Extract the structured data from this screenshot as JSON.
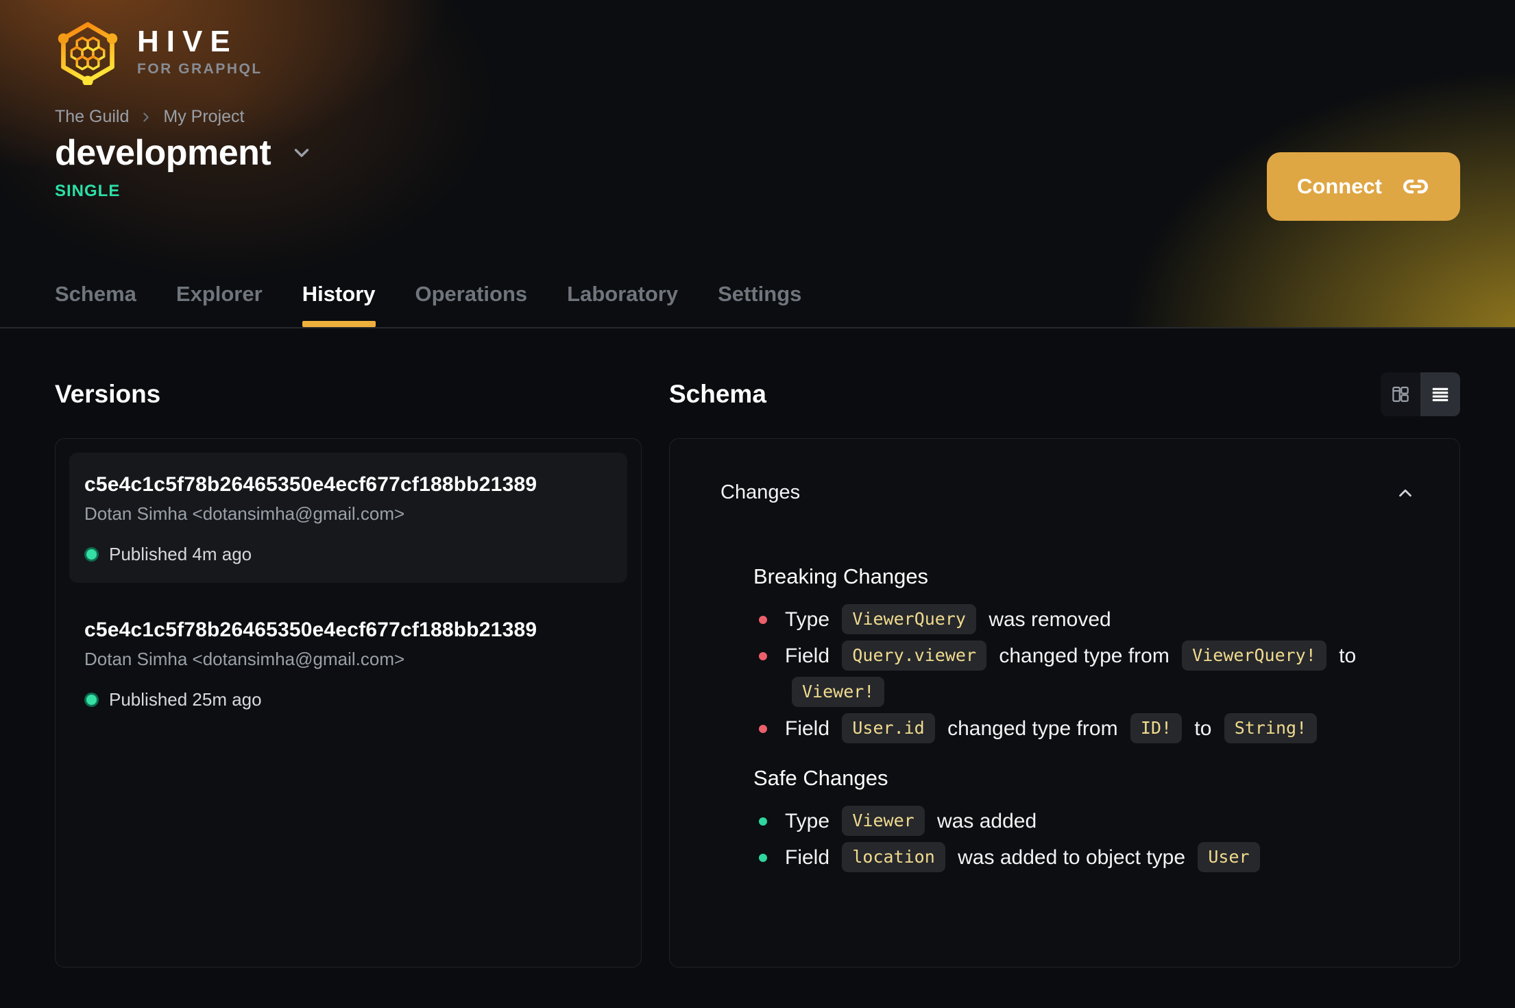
{
  "brand": {
    "name": "HIVE",
    "tagline": "FOR GRAPHQL"
  },
  "breadcrumb": {
    "org": "The Guild",
    "project": "My Project"
  },
  "page_header": {
    "target_name": "development",
    "target_type": "SINGLE",
    "connect_label": "Connect"
  },
  "tabs": [
    {
      "label": "Schema"
    },
    {
      "label": "Explorer"
    },
    {
      "label": "History"
    },
    {
      "label": "Operations"
    },
    {
      "label": "Laboratory"
    },
    {
      "label": "Settings"
    }
  ],
  "active_tab": "History",
  "versions": {
    "heading": "Versions",
    "items": [
      {
        "hash": "c5e4c1c5f78b26465350e4ecf677cf188bb21389",
        "author": "Dotan Simha <dotansimha@gmail.com>",
        "status": "Published 4m ago"
      },
      {
        "hash": "c5e4c1c5f78b26465350e4ecf677cf188bb21389",
        "author": "Dotan Simha <dotansimha@gmail.com>",
        "status": "Published 25m ago"
      }
    ]
  },
  "schema_view": {
    "heading": "Schema",
    "changes_label": "Changes",
    "breaking": {
      "heading": "Breaking Changes",
      "items": [
        {
          "t0": "Type",
          "c0": "ViewerQuery",
          "t1": "was removed"
        },
        {
          "t0": "Field",
          "c0": "Query.viewer",
          "t1": "changed type from",
          "c1": "ViewerQuery!",
          "t2": "to",
          "c2": "Viewer!"
        },
        {
          "t0": "Field",
          "c0": "User.id",
          "t1": "changed type from",
          "c1": "ID!",
          "t2": "to",
          "c2": "String!"
        }
      ]
    },
    "safe": {
      "heading": "Safe Changes",
      "items": [
        {
          "t0": "Type",
          "c0": "Viewer",
          "t1": "was added"
        },
        {
          "t0": "Field",
          "c0": "location",
          "t1": "was added to object type",
          "c1": "User"
        }
      ]
    }
  },
  "icons": {
    "logo": "hive-honeycomb-icon",
    "breadcrumb_separator": "chevron-right-icon",
    "target_dropdown": "chevron-down-icon",
    "connect": "link-icon",
    "view_split": "columns-icon",
    "view_list": "list-icon",
    "changes_collapse": "chevron-up-icon",
    "version_status": "green-status-dot"
  },
  "colors": {
    "accent_amber": "#efb13b",
    "connect_button": "#dfa644",
    "badge_green": "#2be0a6",
    "breaking_bullet": "#ec5f6b",
    "safe_bullet": "#2fd69e",
    "code_text": "#f1db8e",
    "code_bg": "#26282c",
    "muted_text": "#9ba1a9",
    "page_bg": "#0a0c0f"
  }
}
